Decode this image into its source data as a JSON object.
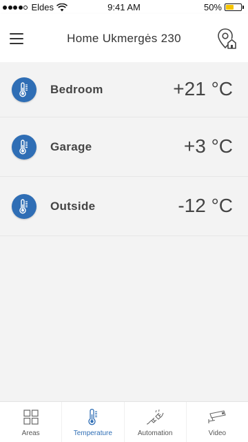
{
  "status_bar": {
    "carrier": "Eldes",
    "time": "9:41 AM",
    "battery_percent": "50%",
    "battery_level": 0.5,
    "battery_color": "#f5c400",
    "signal_bars_filled": 4,
    "signal_bars_total": 5
  },
  "header": {
    "title": "Home Ukmergės 230",
    "menu_icon": "hamburger-icon",
    "location_icon": "location-home-icon"
  },
  "sensors": [
    {
      "name": "Bedroom",
      "value": "+21 °C",
      "icon": "thermometer-icon"
    },
    {
      "name": "Garage",
      "value": "+3 °C",
      "icon": "thermometer-icon"
    },
    {
      "name": "Outside",
      "value": "-12 °C",
      "icon": "thermometer-icon"
    }
  ],
  "tabs": [
    {
      "label": "Areas",
      "icon": "grid-icon",
      "active": false
    },
    {
      "label": "Temperature",
      "icon": "thermometer-icon",
      "active": true
    },
    {
      "label": "Automation",
      "icon": "plug-icon",
      "active": false
    },
    {
      "label": "Video",
      "icon": "camera-icon",
      "active": false
    }
  ],
  "colors": {
    "accent": "#2f6eb5",
    "background": "#f3f3f3",
    "header_bg": "#ffffff",
    "text": "#444444"
  }
}
